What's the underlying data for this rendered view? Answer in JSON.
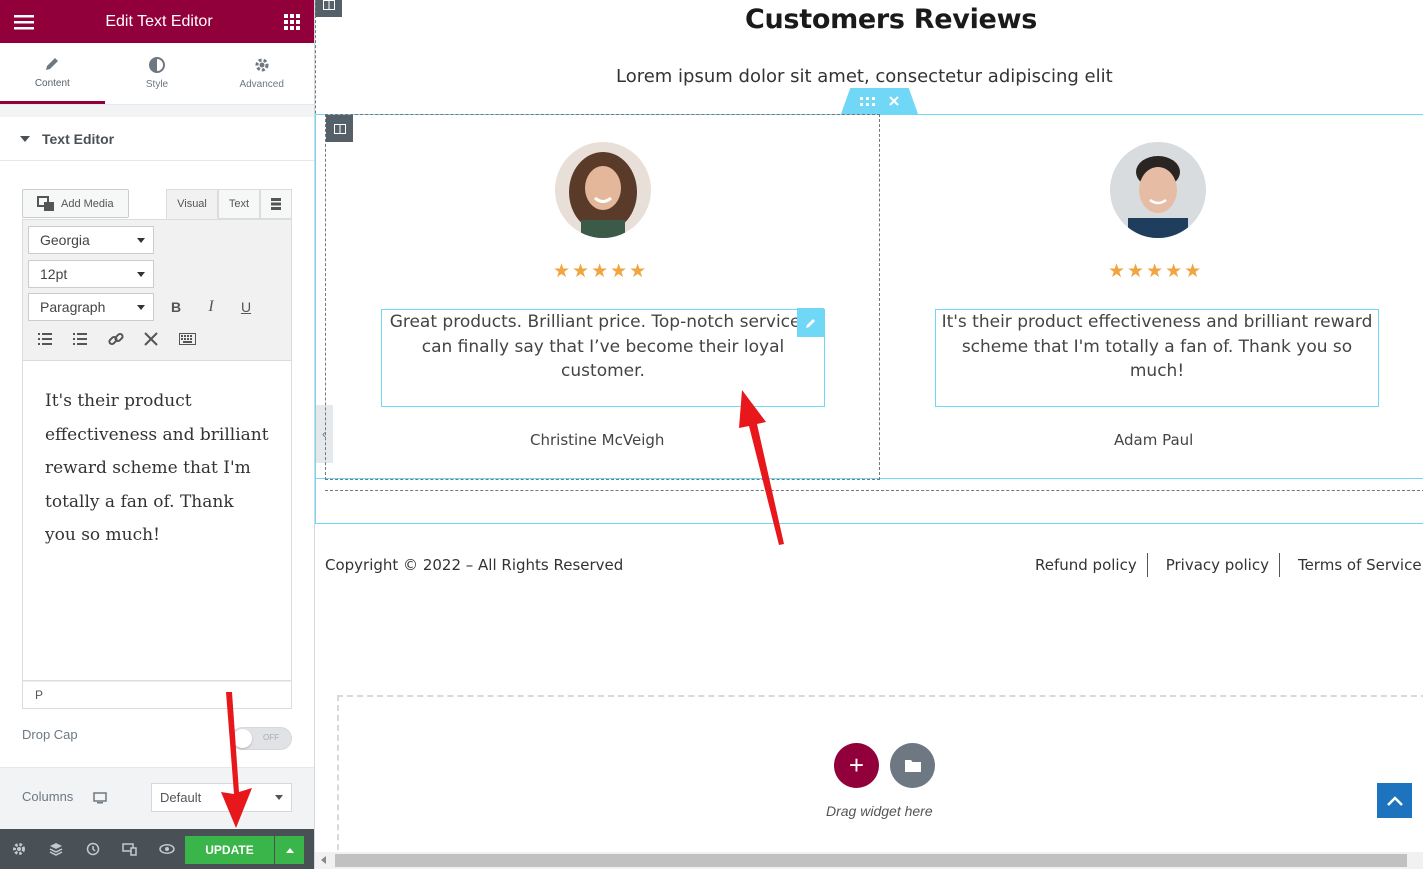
{
  "panel": {
    "title": "Edit Text Editor",
    "tabs": [
      {
        "label": "Content",
        "icon": "pencil-icon"
      },
      {
        "label": "Style",
        "icon": "contrast-icon"
      },
      {
        "label": "Advanced",
        "icon": "gear-icon"
      }
    ],
    "section_title": "Text Editor",
    "add_media": "Add Media",
    "view_tabs": [
      "Visual",
      "Text"
    ],
    "font_family": "Georgia",
    "font_size": "12pt",
    "format": "Paragraph",
    "editor_text": "It's their product effectiveness and brilliant reward scheme that I'm totally a fan of. Thank you so much!",
    "path_label": "P",
    "drop_cap_label": "Drop Cap",
    "drop_cap_state": "OFF",
    "columns_label": "Columns",
    "columns_value": "Default",
    "update_label": "UPDATE"
  },
  "canvas": {
    "heading": "Customers Reviews",
    "subheading": "Lorem ipsum dolor sit amet, consectetur adipiscing elit",
    "reviews": [
      {
        "quote": "Great products. Brilliant price. Top-notch service. I can finally say that I’ve become their loyal customer.",
        "name": "Christine McVeigh",
        "rating": "★★★★★"
      },
      {
        "quote": "It's their product effectiveness and brilliant reward scheme that I'm totally a fan of. Thank you so much!",
        "name": "Adam Paul",
        "rating": "★★★★★"
      }
    ],
    "copyright": "Copyright © 2022 – All Rights Reserved",
    "footer_links": [
      "Refund policy",
      "Privacy policy",
      "Terms of Service"
    ],
    "drag_text": "Drag widget here"
  },
  "colors": {
    "brand": "#92003b",
    "accent": "#71d7f7",
    "update": "#39b54a",
    "star": "#f0a540"
  }
}
